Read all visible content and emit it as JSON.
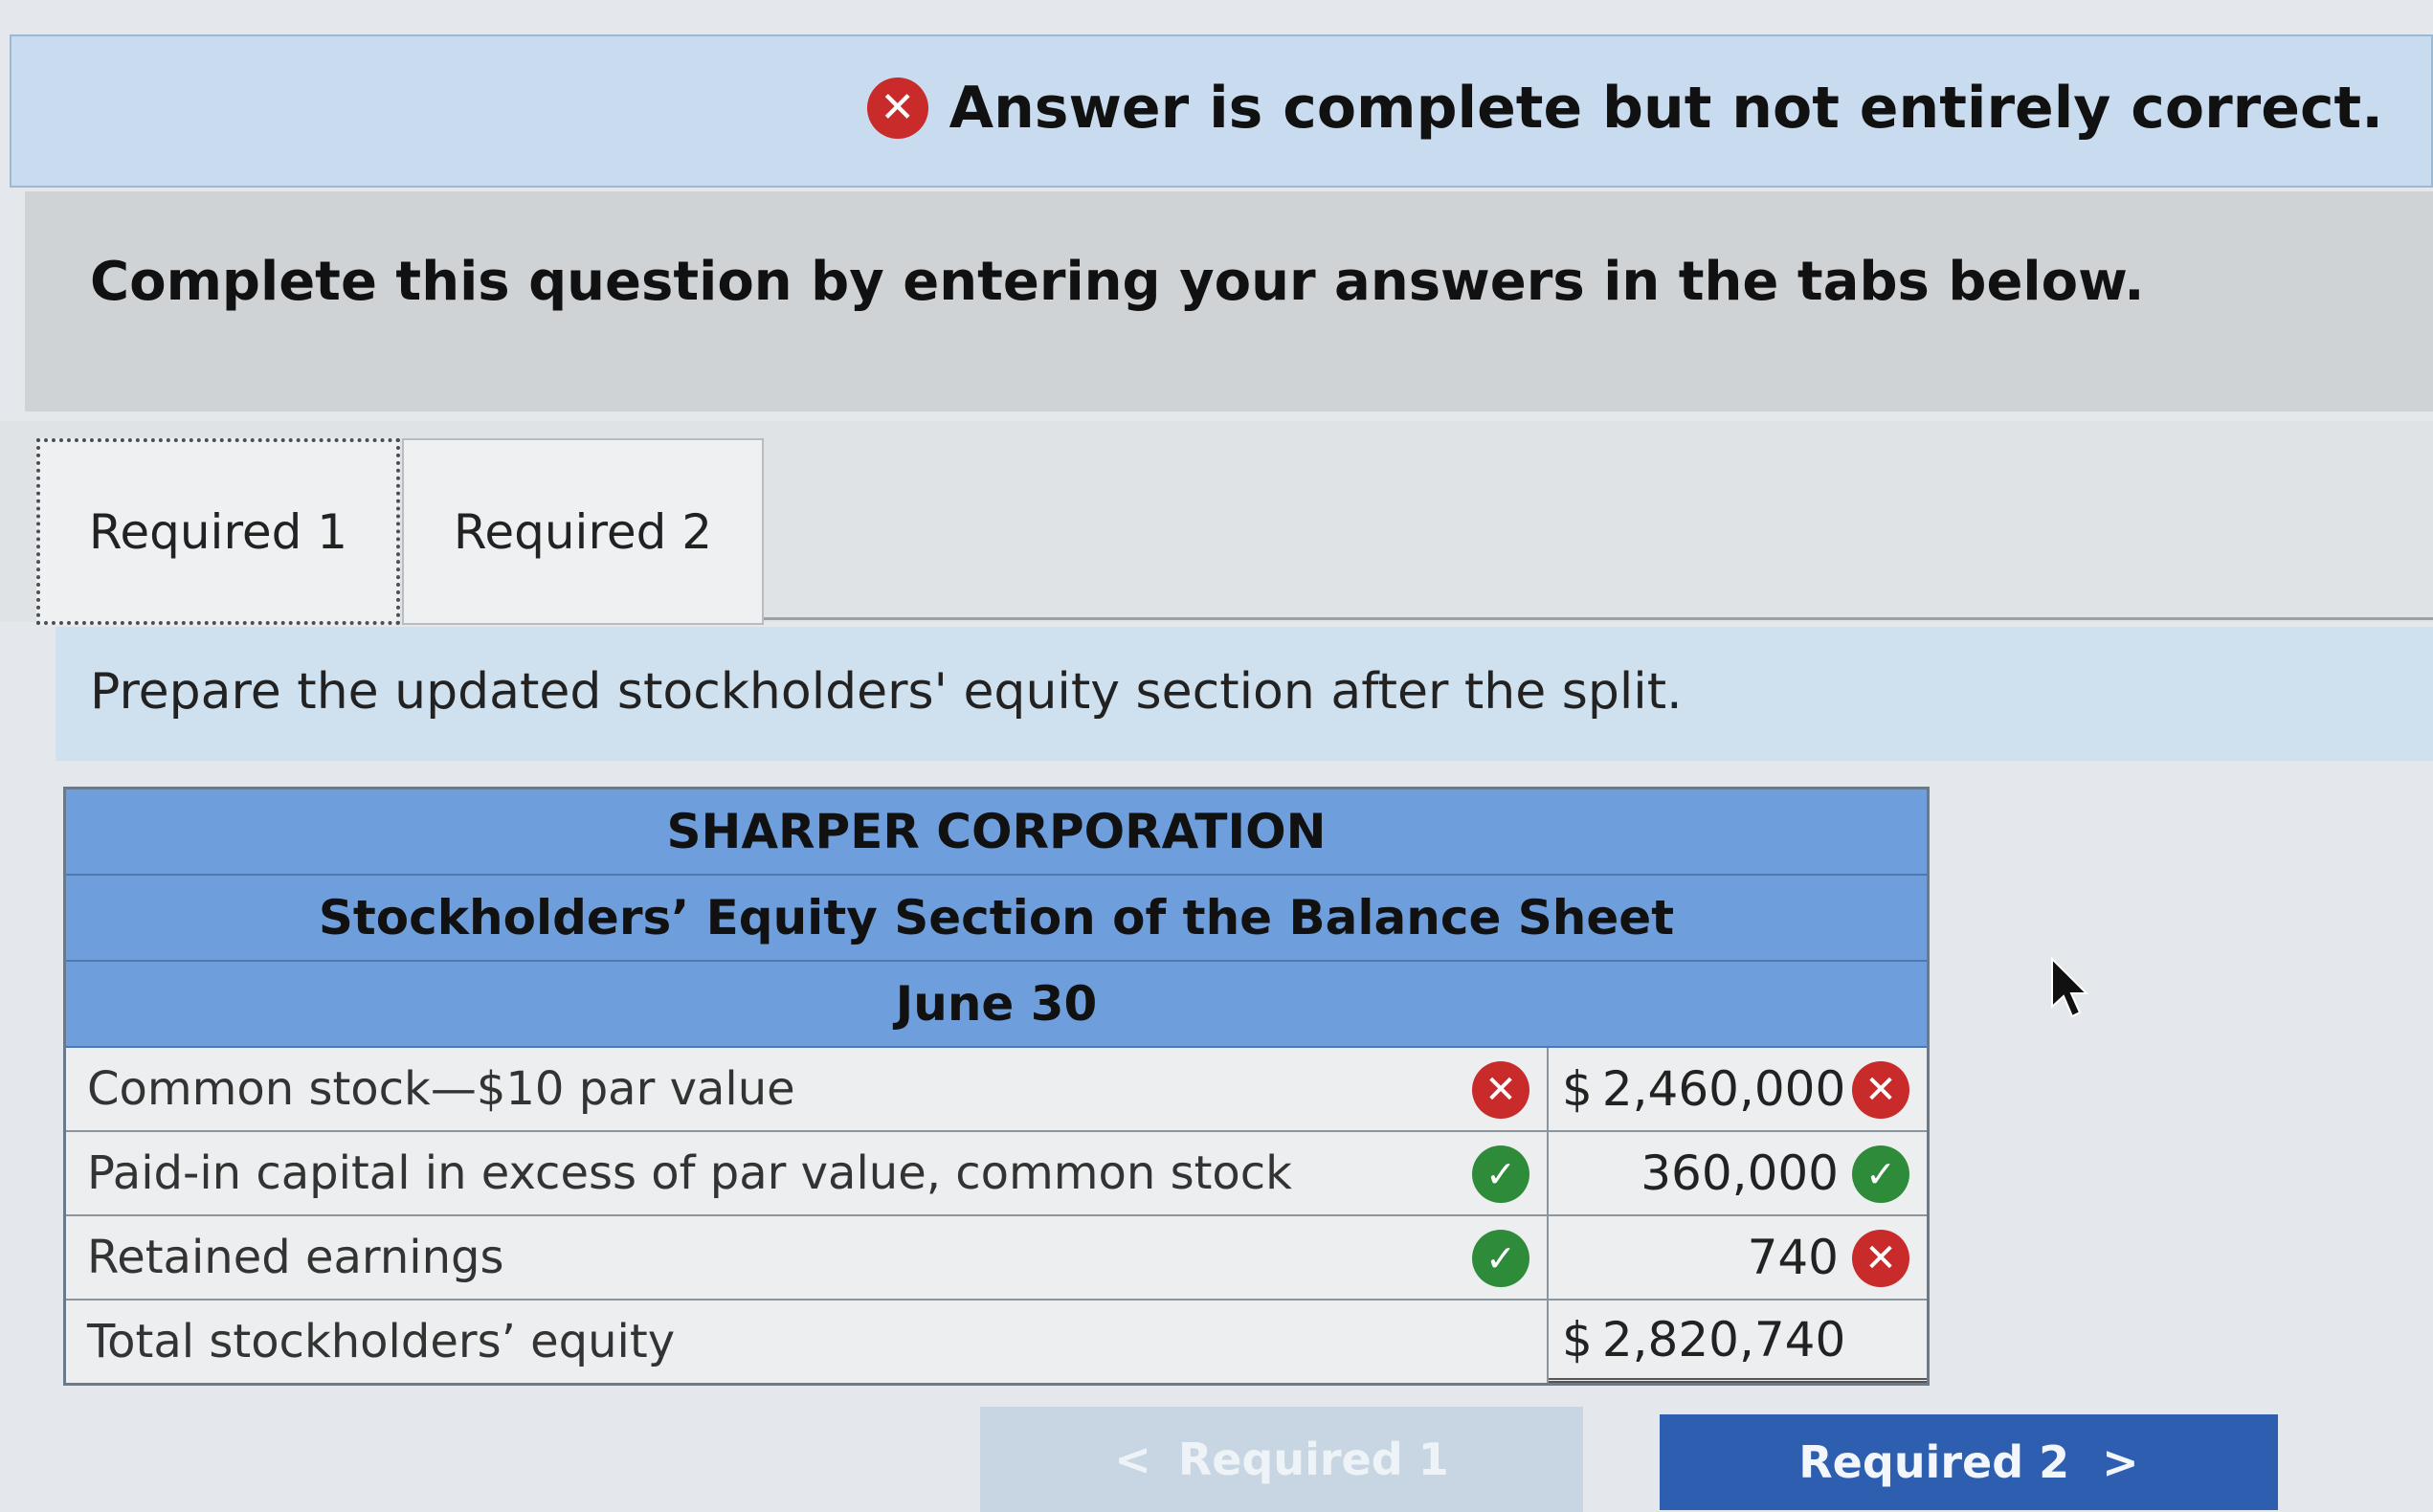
{
  "banner": {
    "status_icon": "x-circle-icon",
    "message": "Answer is complete but not entirely correct."
  },
  "instruction": "Complete this question by entering your answers in the tabs below.",
  "tabs": [
    {
      "label": "Required 1",
      "active": true
    },
    {
      "label": "Required 2",
      "active": false
    }
  ],
  "prompt": "Prepare the updated stockholders' equity section after the split.",
  "sheet": {
    "company": "SHARPER CORPORATION",
    "title": "Stockholders’ Equity Section of the Balance Sheet",
    "date": "June 30",
    "rows": [
      {
        "label": "Common stock—$10 par value",
        "label_status": "incorrect",
        "currency": "$",
        "value": "2,460,000",
        "value_status": "incorrect"
      },
      {
        "label": "Paid-in capital in excess of par value, common stock",
        "label_status": "correct",
        "currency": "",
        "value": "360,000",
        "value_status": "correct"
      },
      {
        "label": "Retained earnings",
        "label_status": "correct",
        "currency": "",
        "value": "740",
        "value_status": "incorrect"
      },
      {
        "label": "Total stockholders’ equity",
        "currency": "$",
        "value": "2,820,740"
      }
    ]
  },
  "nav": {
    "prev_label": "Required 1",
    "next_label": "Required 2",
    "prev_icon": "<",
    "next_icon": ">"
  },
  "colors": {
    "incorrect": "#c92a2a",
    "correct": "#2e8b3a",
    "header_blue": "#6e9fdc",
    "nav_blue": "#2d5eb0"
  }
}
